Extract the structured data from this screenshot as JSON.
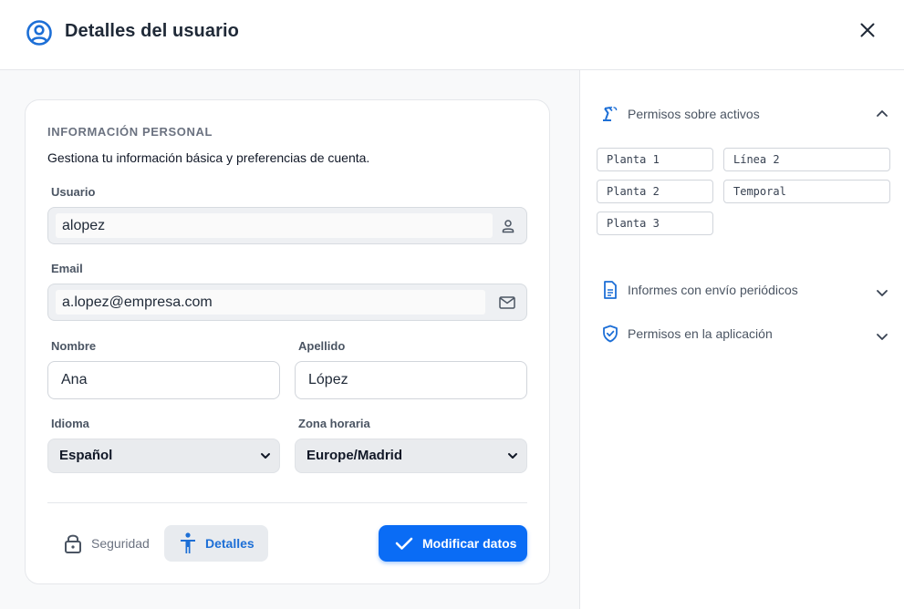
{
  "header": {
    "title": "Detalles del usuario"
  },
  "personal": {
    "section_title": "INFORMACIÓN PERSONAL",
    "description": "Gestiona tu información básica y preferencias de cuenta.",
    "usuario_label": "Usuario",
    "usuario_value": "alopez",
    "email_label": "Email",
    "email_value": "a.lopez@empresa.com",
    "nombre_label": "Nombre",
    "nombre_value": "Ana",
    "apellido_label": "Apellido",
    "apellido_value": "López",
    "idioma_label": "Idioma",
    "idioma_value": "Español",
    "zona_label": "Zona horaria",
    "zona_value": "Europe/Madrid"
  },
  "actions": {
    "security_label": "Seguridad",
    "details_label": "Detalles",
    "modify_label": "Modificar datos"
  },
  "permissions": {
    "assets_title": "Permisos sobre activos",
    "assets": [
      "Planta 1",
      "Línea 2",
      "Planta 2",
      "Temporal",
      "Planta 3"
    ],
    "reports_title": "Informes con envío periódicos",
    "app_title": "Permisos en la aplicación"
  },
  "colors": {
    "accent": "#0a6cf5",
    "icon_blue": "#1d6fd6"
  }
}
